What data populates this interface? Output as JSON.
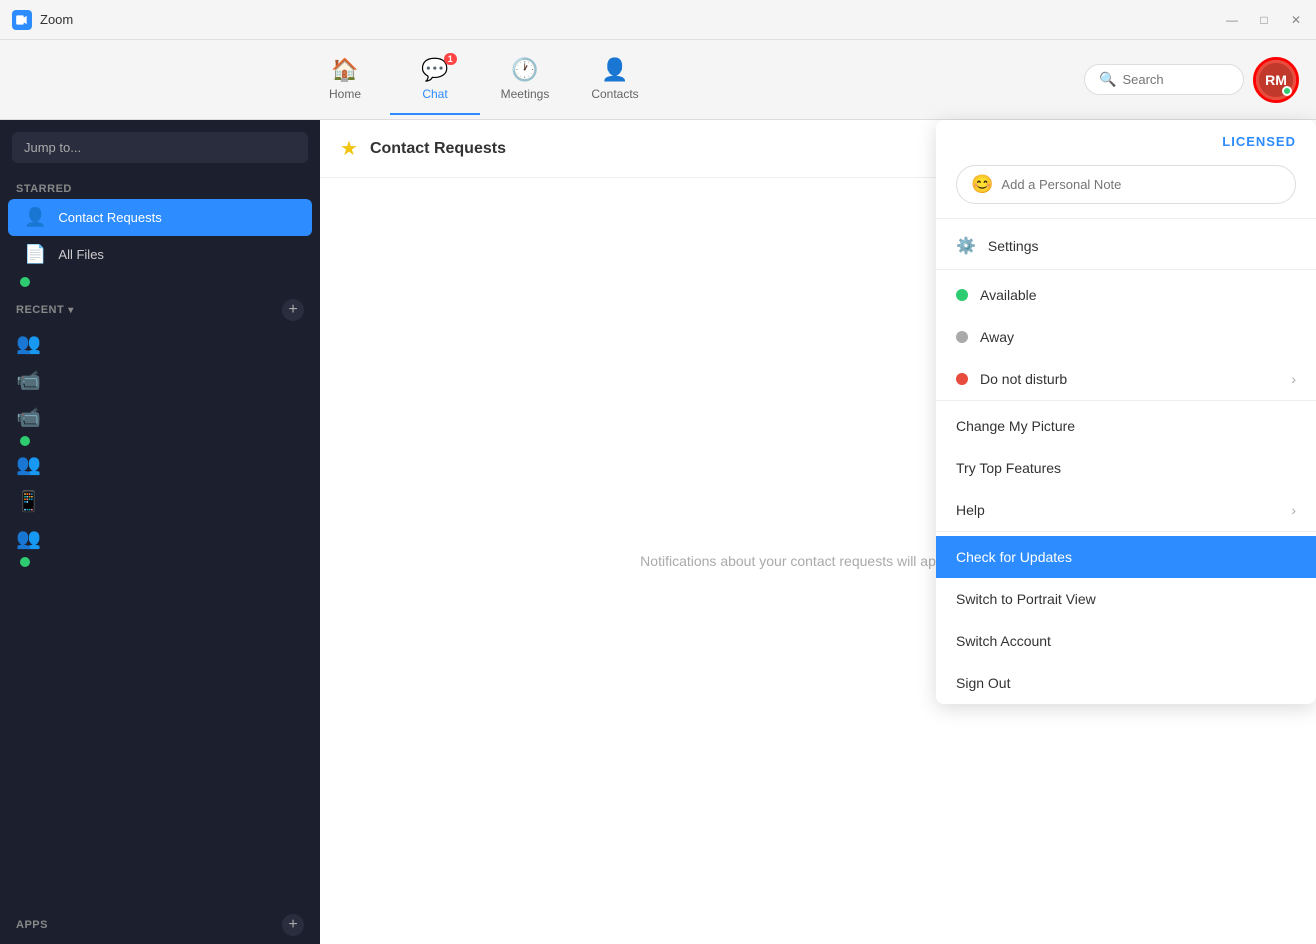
{
  "window": {
    "title": "Zoom",
    "controls": [
      "—",
      "□",
      "✕"
    ]
  },
  "nav": {
    "tabs": [
      {
        "id": "home",
        "label": "Home",
        "icon": "🏠",
        "badge": null,
        "active": false
      },
      {
        "id": "chat",
        "label": "Chat",
        "icon": "💬",
        "badge": "1",
        "active": true
      },
      {
        "id": "meetings",
        "label": "Meetings",
        "icon": "🕐",
        "badge": null,
        "active": false
      },
      {
        "id": "contacts",
        "label": "Contacts",
        "icon": "👤",
        "badge": null,
        "active": false
      }
    ],
    "search_placeholder": "Search",
    "avatar_initials": "RM"
  },
  "sidebar": {
    "jump_to_placeholder": "Jump to...",
    "starred_label": "STARRED",
    "starred_items": [
      {
        "id": "contact-requests",
        "icon": "👤",
        "label": "Contact Requests",
        "active": true
      },
      {
        "id": "all-files",
        "icon": "📄",
        "label": "All Files",
        "active": false
      }
    ],
    "recent_label": "RECENT",
    "recent_items": [
      {
        "id": "group1",
        "icon": "👥",
        "color": "normal"
      },
      {
        "id": "video1",
        "icon": "📹",
        "color": "red"
      },
      {
        "id": "video2",
        "icon": "📹",
        "color": "red"
      },
      {
        "id": "group2",
        "icon": "👥",
        "color": "normal"
      },
      {
        "id": "tablet",
        "icon": "📱",
        "color": "normal"
      },
      {
        "id": "group3",
        "icon": "👥",
        "color": "normal"
      }
    ],
    "apps_label": "APPS"
  },
  "content": {
    "title": "Contact Requests",
    "body_text": "Notifications about your contact requests will appear here"
  },
  "dropdown": {
    "licensed_label": "LICENSED",
    "note_placeholder": "Add a Personal Note",
    "items": [
      {
        "id": "settings",
        "icon": "⚙️",
        "label": "Settings",
        "has_dot": false,
        "has_chevron": false
      },
      {
        "id": "available",
        "label": "Available",
        "dot_color": "green",
        "has_chevron": false
      },
      {
        "id": "away",
        "label": "Away",
        "dot_color": "gray",
        "has_chevron": false
      },
      {
        "id": "do-not-disturb",
        "label": "Do not disturb",
        "dot_color": "red",
        "has_chevron": true
      },
      {
        "id": "change-picture",
        "label": "Change My Picture",
        "has_chevron": false
      },
      {
        "id": "try-features",
        "label": "Try Top Features",
        "has_chevron": false
      },
      {
        "id": "help",
        "label": "Help",
        "has_chevron": true
      },
      {
        "id": "check-updates",
        "label": "Check for Updates",
        "highlighted": true,
        "has_chevron": false
      },
      {
        "id": "portrait-view",
        "label": "Switch to Portrait View",
        "has_chevron": false
      },
      {
        "id": "switch-account",
        "label": "Switch Account",
        "has_chevron": false
      },
      {
        "id": "sign-out",
        "label": "Sign Out",
        "has_chevron": false
      }
    ]
  }
}
